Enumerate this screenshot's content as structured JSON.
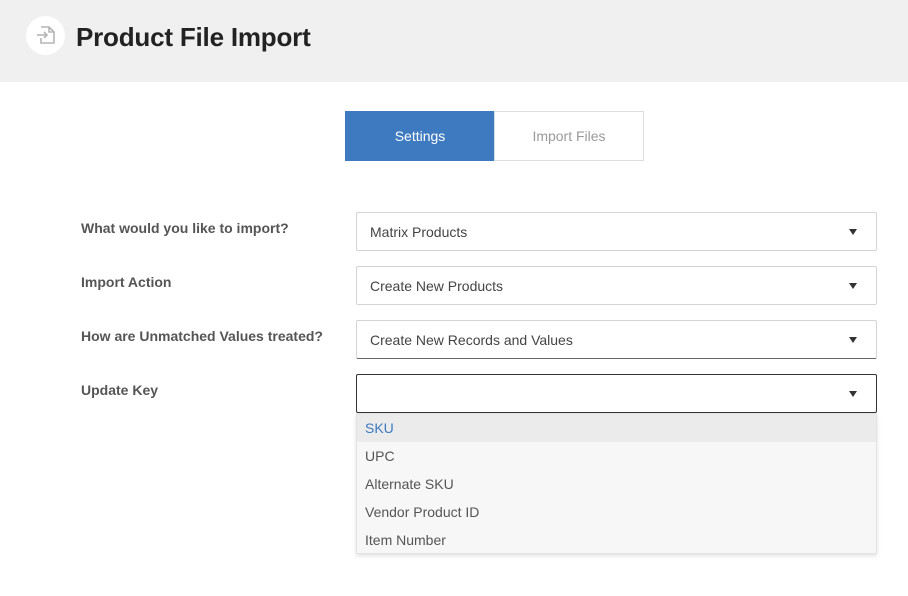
{
  "header": {
    "title": "Product File Import",
    "icon": "file-import-icon"
  },
  "tabs": [
    {
      "label": "Settings",
      "active": true
    },
    {
      "label": "Import Files",
      "active": false
    }
  ],
  "form": {
    "fields": [
      {
        "label": "What would you like to import?",
        "value": "Matrix Products"
      },
      {
        "label": "Import Action",
        "value": "Create New Products"
      },
      {
        "label": "How are Unmatched Values treated?",
        "value": "Create New Records and Values"
      },
      {
        "label": "Update Key",
        "value": ""
      }
    ]
  },
  "dropdown": {
    "options": [
      "SKU",
      "UPC",
      "Alternate SKU",
      "Vendor Product ID",
      "Item Number"
    ],
    "highlighted_index": 0
  },
  "colors": {
    "accent": "#3d7abf",
    "header_bg": "#f1f0f0"
  }
}
